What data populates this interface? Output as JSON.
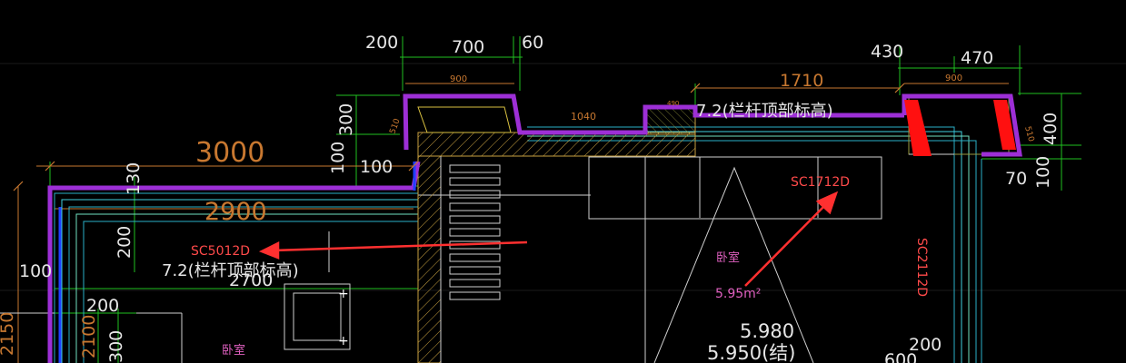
{
  "colors": {
    "background": "#000000",
    "wall_outline": "#9d2fd6",
    "dimension_line": "#21c021",
    "dimension_text": "#e6e6e6",
    "orange_dimension": "#c87830",
    "hatch": "#c8a040",
    "window_layer": "#2ab0c8",
    "tag_text": "#e060c0",
    "window_tag": "#ff4a4a",
    "annotation_arrow": "#ff3030",
    "structure_red": "#ff1010",
    "blue_line": "#2040ff"
  },
  "dimensions": {
    "d200_top": "200",
    "d700": "700",
    "d60": "60",
    "d900_left": "900",
    "d510_left": "510",
    "d300": "300",
    "d1040": "1040",
    "d490": "490",
    "d1710": "1710",
    "d430": "430",
    "d470": "470",
    "d900_right": "900",
    "d510_right": "510",
    "d400": "400",
    "d100_right": "100",
    "d70": "70",
    "d3000": "3000",
    "d100_left_upper": "100",
    "d100_mid": "100",
    "d2900": "2900",
    "d2700": "2700",
    "d100_left": "100",
    "d130": "130",
    "d200_vertical": "200",
    "d200_bottom": "200",
    "d2100": "2100",
    "d300_bottom": "300",
    "d2150": "2150",
    "d200_right_bottom": "200",
    "d600": "600"
  },
  "labels": {
    "railing_left": "7.2(栏杆顶部标高)",
    "railing_right": "7.2(栏杆顶部标高)",
    "window_sc5012": "SC5012D",
    "window_sc1712": "SC1712D",
    "window_sc2112": "SC2112D",
    "room_bedroom_center": "卧室",
    "room_bedroom_left": "卧室",
    "area": "5.95m²",
    "elev_5980": "5.980",
    "elev_5950": "5.950(结)"
  }
}
